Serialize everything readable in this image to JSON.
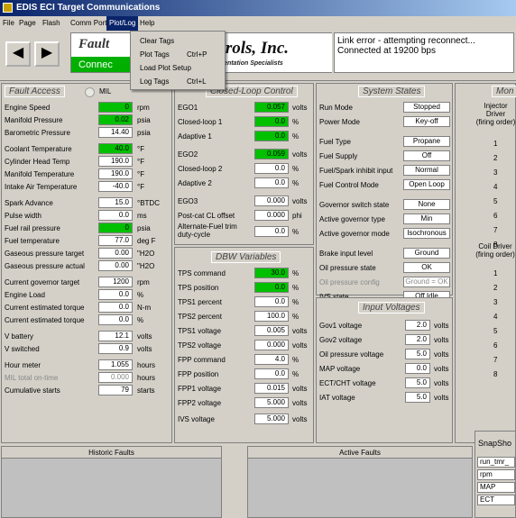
{
  "window": {
    "title": "EDIS ECI Target Communications"
  },
  "menu": [
    {
      "label": "File"
    },
    {
      "label": "Page"
    },
    {
      "label": "Flash"
    },
    {
      "label": "Comm Port"
    },
    {
      "label": "Plot/Log"
    },
    {
      "label": "Help"
    }
  ],
  "plot_menu": [
    {
      "label": "Clear Tags",
      "shortcut": ""
    },
    {
      "label": "Plot Tags",
      "shortcut": "Ctrl+P"
    },
    {
      "label": "Load Plot Setup",
      "shortcut": ""
    },
    {
      "label": "Log Tags",
      "shortcut": "Ctrl+L"
    }
  ],
  "header": {
    "fault_word": "Fault",
    "connected_text": "Connec",
    "logo_text": "ntrols, Inc.",
    "logo_sub": "and Instrumentation Specialists",
    "status_line1": "Link error - attempting reconnect...",
    "status_line2": "Connected at 19200 bps"
  },
  "fault_access": {
    "title": "Fault Access",
    "mil_label": "MIL",
    "rows": [
      {
        "label": "Engine Speed",
        "value": "0",
        "unit": "rpm",
        "green": true
      },
      {
        "label": "Manifold Pressure",
        "value": "0.02",
        "unit": "psia",
        "green": true
      },
      {
        "label": "Barometric Pressure",
        "value": "14.40",
        "unit": "psia",
        "green": false
      },
      {
        "label": "Coolant Temperature",
        "value": "40.0",
        "unit": "°F",
        "green": true
      },
      {
        "label": "Cylinder Head Temp",
        "value": "190.0",
        "unit": "°F",
        "green": false
      },
      {
        "label": "Manifold Temperature",
        "value": "190.0",
        "unit": "°F",
        "green": false
      },
      {
        "label": "Intake Air Temperature",
        "value": "-40.0",
        "unit": "°F",
        "green": false
      },
      {
        "label": "Spark Advance",
        "value": "15.0",
        "unit": "°BTDC",
        "green": false
      },
      {
        "label": "Pulse width",
        "value": "0.0",
        "unit": "ms",
        "green": false
      },
      {
        "label": "Fuel rail pressure",
        "value": "0",
        "unit": "psia",
        "green": true
      },
      {
        "label": "Fuel temperature",
        "value": "77.0",
        "unit": "deg F",
        "green": false
      },
      {
        "label": "Gaseous pressure target",
        "value": "0.00",
        "unit": "\"H2O",
        "green": false
      },
      {
        "label": "Gaseous pressure actual",
        "value": "0.00",
        "unit": "\"H2O",
        "green": false
      },
      {
        "label": "Current governor target",
        "value": "1200",
        "unit": "rpm",
        "green": false
      },
      {
        "label": "Engine Load",
        "value": "0.0",
        "unit": "%",
        "green": false
      },
      {
        "label": "Current estimated torque",
        "value": "0.0",
        "unit": "N-m",
        "green": false
      },
      {
        "label": "Current estimated torque",
        "value": "0.0",
        "unit": "%",
        "green": false
      },
      {
        "label": "V battery",
        "value": "12.1",
        "unit": "volts",
        "green": false
      },
      {
        "label": "V switched",
        "value": "0.9",
        "unit": "volts",
        "green": false
      },
      {
        "label": "Hour meter",
        "value": "1.055",
        "unit": "hours",
        "green": false
      },
      {
        "label": "MIL total on-time",
        "value": "0.000",
        "unit": "hours",
        "green": false,
        "dim": true
      },
      {
        "label": "Cumulative starts",
        "value": "79",
        "unit": "starts",
        "green": false
      }
    ]
  },
  "closed_loop": {
    "title": "Closed-Loop Control",
    "rows": [
      {
        "label": "EGO1",
        "value": "0.057",
        "unit": "volts",
        "green": true
      },
      {
        "label": "Closed-loop 1",
        "value": "0.0",
        "unit": "%",
        "green": true
      },
      {
        "label": "Adaptive 1",
        "value": "0.0",
        "unit": "%",
        "green": true
      },
      {
        "label": "EGO2",
        "value": "0.059",
        "unit": "volts",
        "green": true
      },
      {
        "label": "Closed-loop 2",
        "value": "0.0",
        "unit": "%",
        "green": false
      },
      {
        "label": "Adaptive 2",
        "value": "0.0",
        "unit": "%",
        "green": false
      },
      {
        "label": "EGO3",
        "value": "0.000",
        "unit": "volts",
        "green": false
      },
      {
        "label": "Post-cat CL offset",
        "value": "0.000",
        "unit": "phi",
        "green": false
      },
      {
        "label": "Alternate-Fuel trim duty-cycle",
        "value": "0.0",
        "unit": "%",
        "green": false
      }
    ]
  },
  "dbw": {
    "title": "DBW Variables",
    "rows": [
      {
        "label": "TPS command",
        "value": "30.0",
        "unit": "%",
        "green": true
      },
      {
        "label": "TPS position",
        "value": "0.0",
        "unit": "%",
        "green": true
      },
      {
        "label": "TPS1 percent",
        "value": "0.0",
        "unit": "%",
        "green": false
      },
      {
        "label": "TPS2 percent",
        "value": "100.0",
        "unit": "%",
        "green": false
      },
      {
        "label": "TPS1 voltage",
        "value": "0.005",
        "unit": "volts",
        "green": false
      },
      {
        "label": "TPS2 voltage",
        "value": "0.000",
        "unit": "volts",
        "green": false
      },
      {
        "label": "FPP command",
        "value": "4.0",
        "unit": "%",
        "green": false
      },
      {
        "label": "FPP position",
        "value": "0.0",
        "unit": "%",
        "green": false
      },
      {
        "label": "FPP1 voltage",
        "value": "0.015",
        "unit": "volts",
        "green": false
      },
      {
        "label": "FPP2 voltage",
        "value": "5.000",
        "unit": "volts",
        "green": false
      },
      {
        "label": "IVS voltage",
        "value": "5.000",
        "unit": "volts",
        "green": false
      }
    ]
  },
  "system_states": {
    "title": "System States",
    "rows": [
      {
        "label": "Run Mode",
        "value": "Stopped"
      },
      {
        "label": "Power Mode",
        "value": "Key-off"
      },
      {
        "label": "Fuel Type",
        "value": "Propane"
      },
      {
        "label": "Fuel Supply",
        "value": "Off"
      },
      {
        "label": "Fuel/Spark inhibit input",
        "value": "Normal"
      },
      {
        "label": "Fuel Control Mode",
        "value": "Open Loop"
      },
      {
        "label": "Governor switch state",
        "value": "None"
      },
      {
        "label": "Active governor type",
        "value": "Min"
      },
      {
        "label": "Active governor mode",
        "value": "Isochronous"
      },
      {
        "label": "Brake input level",
        "value": "Ground"
      },
      {
        "label": "Oil pressure state",
        "value": "OK"
      },
      {
        "label": "Oil pressure config",
        "value": "Ground = OK",
        "dim": true
      },
      {
        "label": "IVS state",
        "value": "Off Idle"
      }
    ]
  },
  "input_voltages": {
    "title": "Input Voltages",
    "rows": [
      {
        "label": "Gov1 voltage",
        "value": "2.0",
        "unit": "volts"
      },
      {
        "label": "Gov2 voltage",
        "value": "2.0",
        "unit": "volts"
      },
      {
        "label": "Oil pressure voltage",
        "value": "5.0",
        "unit": "volts"
      },
      {
        "label": "MAP voltage",
        "value": "0.0",
        "unit": "volts"
      },
      {
        "label": "ECT/CHT voltage",
        "value": "5.0",
        "unit": "volts"
      },
      {
        "label": "IAT voltage",
        "value": "5.0",
        "unit": "volts"
      }
    ]
  },
  "monitor": {
    "title": "Mon",
    "injector_header": [
      "Injector",
      "Driver",
      "(firing order)"
    ],
    "injector_nums": [
      "1",
      "2",
      "3",
      "4",
      "5",
      "6",
      "7",
      "8"
    ],
    "coil_header": [
      "Coil Driver",
      "(firing order)"
    ],
    "coil_nums": [
      "1",
      "2",
      "3",
      "4",
      "5",
      "6",
      "7",
      "8"
    ]
  },
  "bottom": {
    "historic_title": "Historic Faults",
    "active_title": "Active Faults",
    "snapshot_title": "SnapSho",
    "snapshot_items": [
      "run_tmr_",
      "rpm",
      "MAP",
      "ECT"
    ]
  }
}
